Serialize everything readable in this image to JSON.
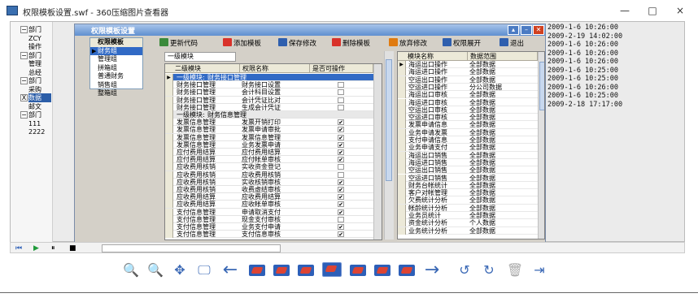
{
  "window": {
    "title": "权限模板设置.swf - 360压缩图片查看器",
    "controls": [
      "—",
      "□",
      "×"
    ]
  },
  "left_panel": {
    "rows": [
      {
        "tree": "−",
        "label": "部门"
      },
      {
        "tree": "",
        "label": "ZCY"
      },
      {
        "tree": "",
        "label": "操作"
      },
      {
        "tree": "−",
        "label": "部门"
      },
      {
        "tree": "",
        "label": "管理"
      },
      {
        "tree": "",
        "label": "总经"
      },
      {
        "tree": "−",
        "label": "部门"
      },
      {
        "tree": "",
        "label": "采购"
      },
      {
        "tree": "X",
        "label": "数据",
        "selected": true
      },
      {
        "tree": "",
        "label": "邮文"
      },
      {
        "tree": "−",
        "label": "部门"
      },
      {
        "tree": "",
        "label": "111"
      },
      {
        "tree": "",
        "label": "2222"
      }
    ]
  },
  "dates": [
    "2009-1-6 10:26:00",
    "2009-2-19 14:02:00",
    "2009-1-6 10:26:00",
    "2009-1-6 10:26:00",
    "2009-1-6 10:26:00",
    "2009-1-6 10:25:00",
    "2009-1-6 10:25:00",
    "2009-1-6 10:26:00",
    "2009-1-6 10:25:00",
    "2009-2-18 17:17:00"
  ],
  "dialog": {
    "title": "权限模板设置",
    "template_list_header": "权限模板",
    "templates": [
      {
        "label": "财务组",
        "selected": true
      },
      {
        "label": "管理组"
      },
      {
        "label": "拼箱组"
      },
      {
        "label": "普通财务"
      },
      {
        "label": "销售组"
      },
      {
        "label": "整箱组"
      }
    ],
    "toolbar": [
      {
        "label": "更新代码",
        "icon": "refresh-icon",
        "color": "#3b8a3b"
      },
      {
        "label": "添加模板",
        "icon": "add-icon",
        "color": "#d9322a"
      },
      {
        "label": "保存修改",
        "icon": "save-icon",
        "color": "#2f5fae"
      },
      {
        "label": "删除模板",
        "icon": "delete-icon",
        "color": "#d9322a"
      },
      {
        "label": "放弃修改",
        "icon": "undo-icon",
        "color": "#e07b10"
      },
      {
        "label": "权限展开",
        "icon": "expand-icon",
        "color": "#2f5fae"
      },
      {
        "label": "退出",
        "icon": "exit-icon",
        "color": "#2f5fae"
      }
    ],
    "module_tab": "一级模块",
    "grid1": {
      "headers": [
        "二级模块",
        "权限名称",
        "是否可操作"
      ],
      "rows": [
        {
          "type": "group",
          "a": "一级模块:",
          "b": "财务接口管理",
          "selected": true
        },
        {
          "a": "财务接口管理",
          "b": "财务接口设置",
          "checked": false
        },
        {
          "a": "财务接口管理",
          "b": "会计科目设置",
          "checked": false
        },
        {
          "a": "财务接口管理",
          "b": "会计凭证比对",
          "checked": false
        },
        {
          "a": "财务接口管理",
          "b": "生成会计凭证",
          "checked": false
        },
        {
          "type": "group",
          "a": "一级模块:",
          "b": "财务信息管理"
        },
        {
          "a": "发票信息管理",
          "b": "发票开销打印",
          "checked": true
        },
        {
          "a": "发票信息管理",
          "b": "发票申请审批",
          "checked": true
        },
        {
          "a": "发票信息管理",
          "b": "发票信息管理",
          "checked": true
        },
        {
          "a": "发票信息管理",
          "b": "业务发票申请",
          "checked": true
        },
        {
          "a": "应付费用结算",
          "b": "应付费用结算",
          "checked": true
        },
        {
          "a": "应付费用结算",
          "b": "应付帐单审核",
          "checked": true
        },
        {
          "a": "应收费用核销",
          "b": "实收资金登记",
          "checked": false
        },
        {
          "a": "应收费用核销",
          "b": "应收费用核销",
          "checked": false
        },
        {
          "a": "应收费用核销",
          "b": "实收核销审核",
          "checked": true
        },
        {
          "a": "应收费用核销",
          "b": "收费虚结审核",
          "checked": true
        },
        {
          "a": "应收费用结算",
          "b": "应收费用结算",
          "checked": true
        },
        {
          "a": "应收费用结算",
          "b": "应收帐单审核",
          "checked": true
        },
        {
          "a": "支付信息管理",
          "b": "申请取消支付",
          "checked": true
        },
        {
          "a": "支付信息管理",
          "b": "现金支付审核",
          "checked": false
        },
        {
          "a": "支付信息管理",
          "b": "业务支付申请",
          "checked": true
        },
        {
          "a": "支付信息管理",
          "b": "支付信息审核",
          "checked": true
        }
      ]
    },
    "grid2": {
      "headers": [
        "模块名称",
        "数据范围"
      ],
      "rows": [
        {
          "a": "海运出口操作",
          "b": "全部数据",
          "marker": true
        },
        {
          "a": "海运进口操作",
          "b": "全部数据"
        },
        {
          "a": "空运出口操作",
          "b": "全部数据"
        },
        {
          "a": "空运进口操作",
          "b": "分公司数据"
        },
        {
          "a": "海运出口审核",
          "b": "全部数据"
        },
        {
          "a": "海运进口审核",
          "b": "全部数据"
        },
        {
          "a": "空运出口审核",
          "b": "全部数据"
        },
        {
          "a": "空运进口审核",
          "b": "全部数据"
        },
        {
          "a": "发票申请信息",
          "b": "全部数据"
        },
        {
          "a": "业务申请发票",
          "b": "全部数据"
        },
        {
          "a": "支付申请信息",
          "b": "全部数据"
        },
        {
          "a": "业务申请支付",
          "b": "全部数据"
        },
        {
          "a": "海运出口销售",
          "b": "全部数据"
        },
        {
          "a": "海运进口销售",
          "b": "全部数据"
        },
        {
          "a": "空运出口销售",
          "b": "全部数据"
        },
        {
          "a": "空运进口销售",
          "b": "全部数据"
        },
        {
          "a": "财务台帐统计",
          "b": "全部数据"
        },
        {
          "a": "客户对帐管理",
          "b": "全部数据"
        },
        {
          "a": "欠费统计分析",
          "b": "全部数据"
        },
        {
          "a": "帐龄统计分析",
          "b": "全部数据"
        },
        {
          "a": "业务员统计",
          "b": "全部数据"
        },
        {
          "a": "资金统计分析",
          "b": "个人数据"
        },
        {
          "a": "业务统计分析",
          "b": "全部数据"
        }
      ]
    }
  },
  "bottom_strip": {
    "items": [
      "⏮",
      "▶",
      "⏸",
      "■"
    ]
  },
  "viewer_tools": {
    "zoom_in": "🔍",
    "zoom_out": "🔍",
    "fit": "✥",
    "screen": "🖵",
    "prev": "←",
    "next": "→",
    "rotate_left": "↺",
    "rotate_right": "↻",
    "delete": "🗑",
    "export": "⇥"
  }
}
